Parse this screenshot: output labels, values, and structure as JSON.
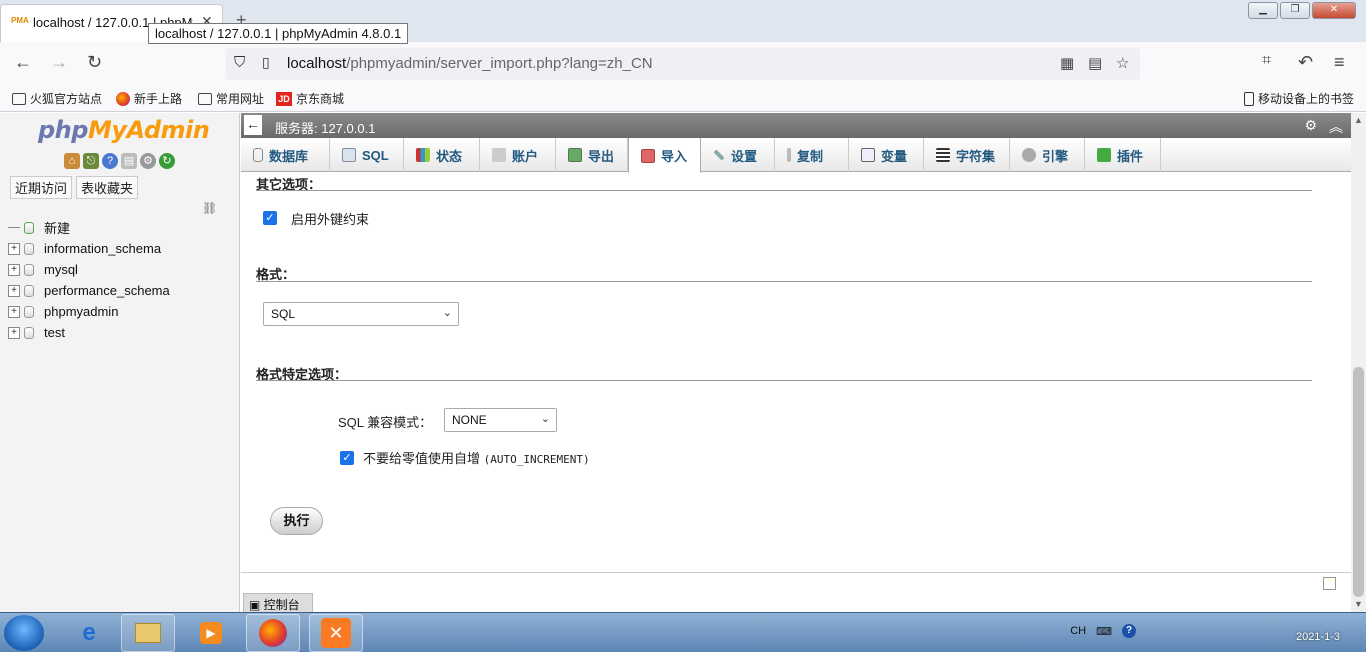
{
  "browser": {
    "tab_title": "localhost / 127.0.0.1 | phpMyAdmin 4.8.0.1",
    "tooltip": "localhost / 127.0.0.1 | phpMyAdmin 4.8.0.1",
    "new_tab": "+",
    "url_host": "localhost",
    "url_path": "/phpmyadmin/server_import.php?lang=zh_CN",
    "bookmarks": [
      "火狐官方站点",
      "新手上路",
      "常用网址",
      "京东商城"
    ],
    "mobile_bookmarks": "移动设备上的书签"
  },
  "left_nav": {
    "logo_php": "php",
    "logo_myadmin": "MyAdmin",
    "tabs": [
      "近期访问",
      "表收藏夹"
    ],
    "tree": [
      {
        "label": "新建",
        "type": "new"
      },
      {
        "label": "information_schema",
        "type": "db"
      },
      {
        "label": "mysql",
        "type": "db"
      },
      {
        "label": "performance_schema",
        "type": "db"
      },
      {
        "label": "phpmyadmin",
        "type": "db"
      },
      {
        "label": "test",
        "type": "db"
      }
    ]
  },
  "main": {
    "server_label": "服务器: 127.0.0.1",
    "menu_tabs": [
      "数据库",
      "SQL",
      "状态",
      "账户",
      "导出",
      "导入",
      "设置",
      "复制",
      "变量",
      "字符集",
      "引擎",
      "插件"
    ],
    "active_tab": "导入",
    "other_options_title": "其它选项：",
    "fk_checkbox_label": "启用外键约束",
    "fk_checked": true,
    "format_title": "格式：",
    "format_value": "SQL",
    "format_specific_title": "格式特定选项：",
    "sql_compat_label": "SQL 兼容模式：",
    "sql_compat_value": "NONE",
    "no_auto_value_label": "不要给零值使用自增",
    "no_auto_value_code": "(AUTO_INCREMENT)",
    "no_auto_value_checked": true,
    "go_button": "执行",
    "console_label": "控制台"
  },
  "taskbar": {
    "tray_lang": "CH",
    "clock": "2021-1-3"
  },
  "colors": {
    "link_blue": "#235a81",
    "checkbox_blue": "#1a73e8",
    "logo_php": "#6c78af",
    "logo_myadmin": "#f89c0e"
  }
}
